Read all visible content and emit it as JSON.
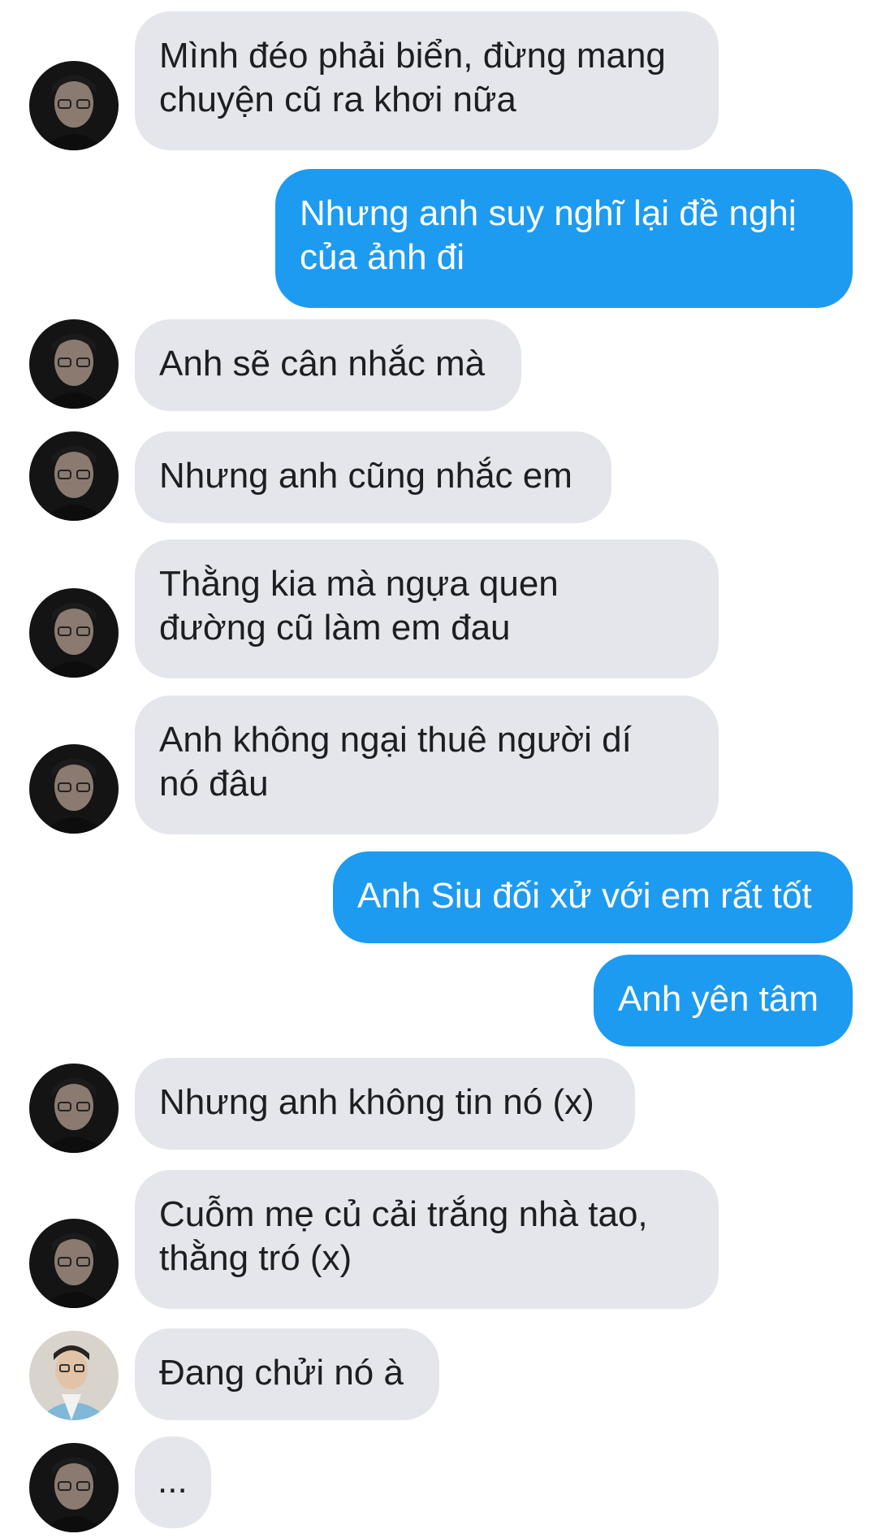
{
  "conversation": {
    "messages": [
      {
        "side": "in",
        "avatar": "man-glasses-avatar",
        "text": "Mình đéo phải biển, đừng mang\nchuyện cũ ra khơi nữa"
      },
      {
        "side": "out",
        "text": "Nhưng anh suy nghĩ lại đề nghị\ncủa ảnh đi"
      },
      {
        "side": "in",
        "avatar": "man-glasses-avatar",
        "text": "Anh sẽ cân nhắc mà"
      },
      {
        "side": "in",
        "avatar": "man-glasses-avatar",
        "text": "Nhưng anh cũng nhắc em"
      },
      {
        "side": "in",
        "avatar": "man-glasses-avatar",
        "text": "Thằng kia mà ngựa quen\nđường cũ làm em đau"
      },
      {
        "side": "in",
        "avatar": "man-glasses-avatar",
        "text": "Anh không ngại thuê người dí\nnó đâu"
      },
      {
        "side": "out",
        "text": "Anh Siu đối xử với em rất tốt"
      },
      {
        "side": "out",
        "text": "Anh yên tâm"
      },
      {
        "side": "in",
        "avatar": "man-glasses-avatar",
        "text": "Nhưng anh không tin nó (x)"
      },
      {
        "side": "in",
        "avatar": "man-glasses-avatar",
        "text": "Cuỗm mẹ củ cải trắng nhà tao,\nthằng tró (x)"
      },
      {
        "side": "in",
        "avatar": "man-blue-outfit-avatar",
        "text": "Đang chửi nó à"
      },
      {
        "side": "in",
        "avatar": "man-glasses-avatar",
        "text": "..."
      }
    ]
  },
  "colors": {
    "incoming_bubble": "#e4e6eb",
    "outgoing_bubble": "#1d9bf0",
    "incoming_text": "#1c1e21",
    "outgoing_text": "#ffffff",
    "background": "#ffffff"
  }
}
